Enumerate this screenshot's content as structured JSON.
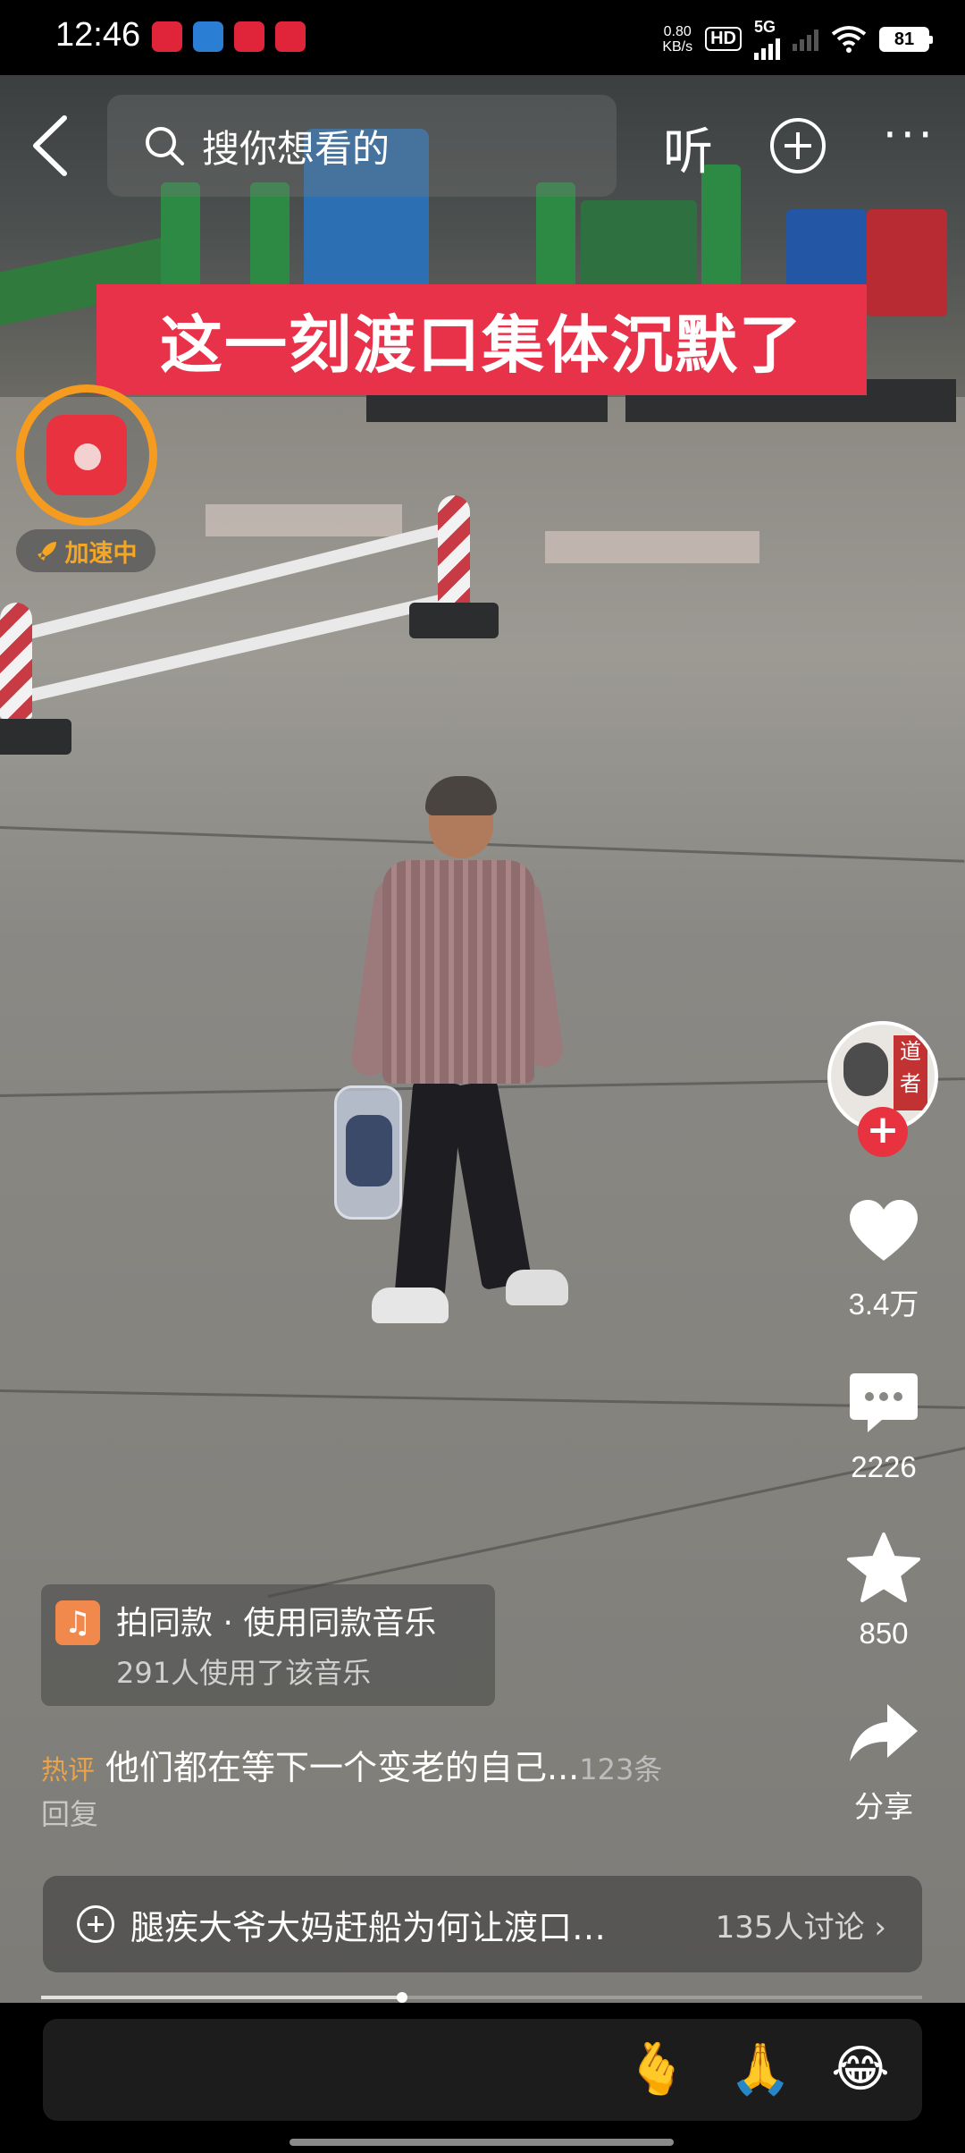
{
  "status_bar": {
    "time": "12:46",
    "net_speed": "0.80",
    "net_speed_unit": "KB/s",
    "hd_label": "HD",
    "network": "5G",
    "battery": "81"
  },
  "top_bar": {
    "search_placeholder": "搜你想看的",
    "listen_label": "听"
  },
  "video": {
    "caption": "这一刻渡口集体沉默了"
  },
  "red_packet": {
    "badge_label": "加速中"
  },
  "creator": {
    "seal_text": "道者"
  },
  "actions": {
    "like_count": "3.4万",
    "comment_count": "2226",
    "favorite_count": "850",
    "share_label": "分享"
  },
  "music": {
    "title": "拍同款 · 使用同款音乐",
    "usage": "291人使用了该音乐"
  },
  "hot_comment": {
    "tag": "热评",
    "text": "他们都在等下一个变老的自己...",
    "count": "123条",
    "reply": "回复"
  },
  "topic": {
    "text": "腿疾大爷大妈赶船为何让渡口…",
    "count": "135人讨论"
  },
  "playback": {
    "progress": 0.41
  },
  "bottom_bar": {
    "emojis": [
      "🫰",
      "🙏",
      "😂"
    ]
  }
}
